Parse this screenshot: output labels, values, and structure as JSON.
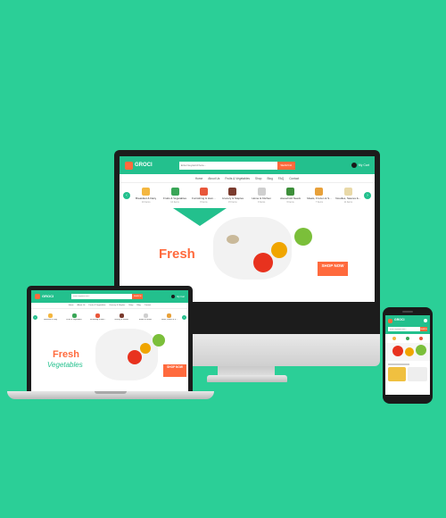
{
  "brand": {
    "name": "GROCI",
    "tagline": "online grocery store"
  },
  "search": {
    "placeholder": "Enter keyword here...",
    "button": "SEARCH"
  },
  "cart": {
    "label": "My Cart"
  },
  "nav": [
    "Home",
    "About Us",
    "Fruits & Vegetables",
    "Grocery & Staples",
    "Shop",
    "Blog",
    "FAQ",
    "Contact"
  ],
  "categories": [
    {
      "label": "Breakfast & Dairy",
      "count": "10 Items",
      "color": "#f4b740"
    },
    {
      "label": "Fruits & Vegetables",
      "count": "12 Items",
      "color": "#3aa657"
    },
    {
      "label": "Furnishing & Hom...",
      "count": "8 Items",
      "color": "#e8573a"
    },
    {
      "label": "Grocery & Staples",
      "count": "15 Items",
      "color": "#7a3b2e"
    },
    {
      "label": "Home & Kitchen",
      "count": "9 Items",
      "color": "#cfcfcf"
    },
    {
      "label": "Household Needs",
      "count": "6 Items",
      "color": "#3d8f3a"
    },
    {
      "label": "Meats, Frozen & S...",
      "count": "7 Items",
      "color": "#e8a13a"
    },
    {
      "label": "Noodles, Sauces &...",
      "count": "11 Items",
      "color": "#e9d9a8"
    }
  ],
  "hero": {
    "fresh": "Fresh",
    "vegetables": "Vegetables",
    "shop": "SHOP NOW"
  },
  "colors": {
    "background": "#2bcf97",
    "brand": "#23c08d",
    "accent": "#ff6a3d"
  }
}
